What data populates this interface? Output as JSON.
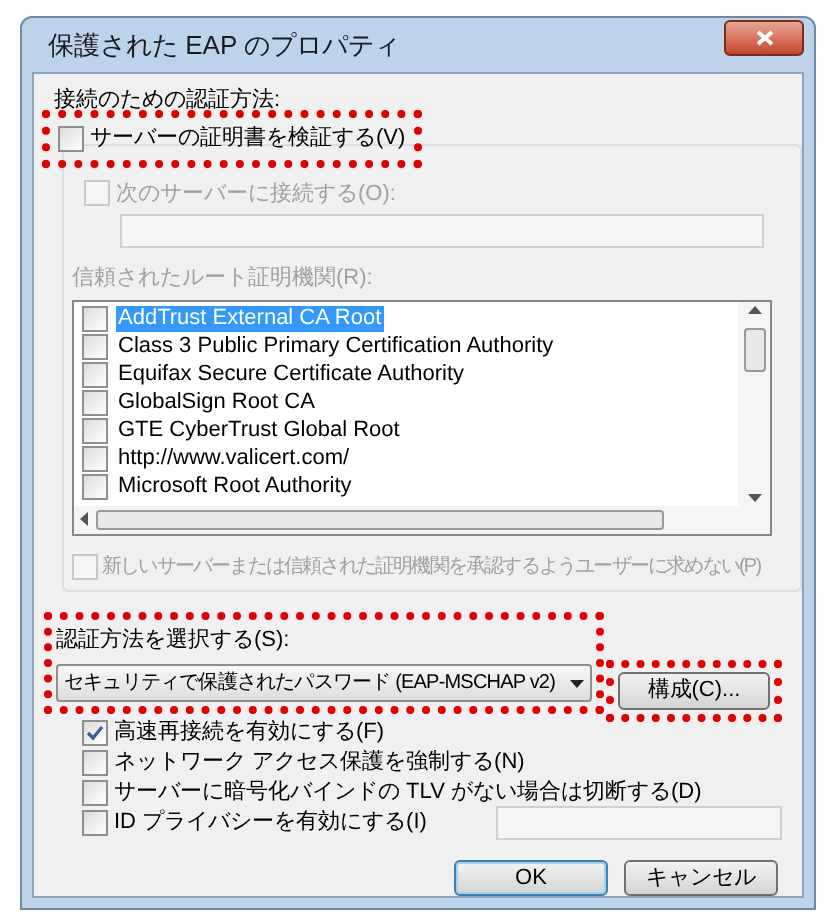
{
  "window": {
    "title": "保護された EAP のプロパティ"
  },
  "auth_section": {
    "label": "接続のための認証方法:"
  },
  "verify_cert": {
    "label": "サーバーの証明書を検証する(V)",
    "checked": false,
    "highlighted": true
  },
  "connect_servers": {
    "label": "次のサーバーに接続する(O):",
    "checked": false,
    "disabled": true
  },
  "trusted_roots": {
    "label": "信頼されたルート証明機関(R):",
    "items": [
      {
        "name": "AddTrust External CA Root",
        "checked": false,
        "selected": true
      },
      {
        "name": "Class 3 Public Primary Certification Authority",
        "checked": false,
        "selected": false
      },
      {
        "name": "Equifax Secure Certificate Authority",
        "checked": false,
        "selected": false
      },
      {
        "name": "GlobalSign Root CA",
        "checked": false,
        "selected": false
      },
      {
        "name": "GTE CyberTrust Global Root",
        "checked": false,
        "selected": false
      },
      {
        "name": "http://www.valicert.com/",
        "checked": false,
        "selected": false
      },
      {
        "name": "Microsoft Root Authority",
        "checked": false,
        "selected": false
      }
    ]
  },
  "no_prompt": {
    "label": "新しいサーバーまたは信頼された証明機関を承認するようユーザーに求めない(P)",
    "checked": false,
    "disabled": true
  },
  "method": {
    "label": "認証方法を選択する(S):",
    "value": "セキュリティで保護されたパスワード (EAP-MSCHAP v2)",
    "highlighted": true
  },
  "configure_button": {
    "label": "構成(C)...",
    "highlighted": true
  },
  "options": [
    {
      "kind": "checkbox",
      "label": "高速再接続を有効にする(F)",
      "checked": true
    },
    {
      "kind": "checkbox",
      "label": "ネットワーク アクセス保護を強制する(N)",
      "checked": false
    },
    {
      "kind": "checkbox",
      "label": "サーバーに暗号化バインドの TLV がない場合は切断する(D)",
      "checked": false
    },
    {
      "kind": "checkbox_field",
      "label": "ID プライバシーを有効にする(I)",
      "checked": false
    }
  ],
  "buttons": [
    {
      "label": "OK",
      "default": true
    },
    {
      "label": "キャンセル",
      "default": false
    }
  ]
}
